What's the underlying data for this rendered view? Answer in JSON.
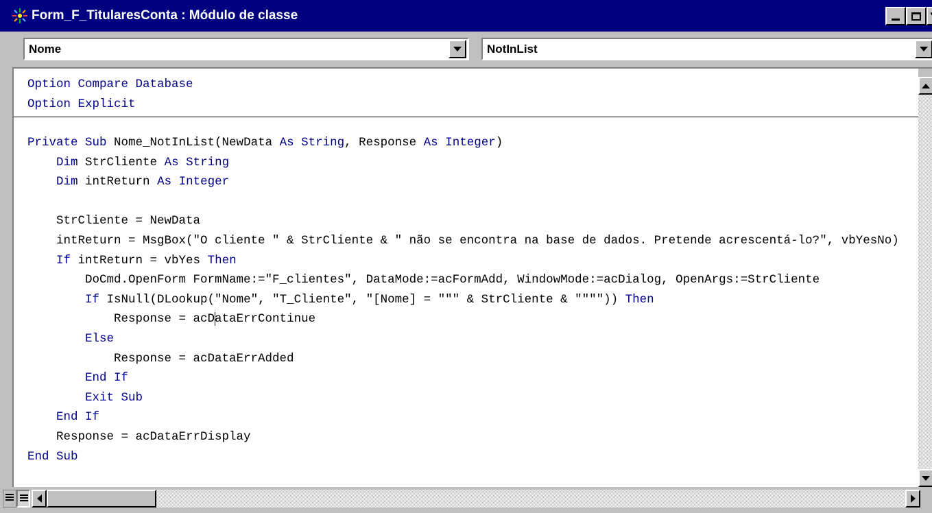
{
  "window": {
    "title": "Form_F_TitularesConta : Módulo de classe",
    "icon": "module-icon",
    "controls": [
      "minimize-icon",
      "maximize-icon",
      "close-icon"
    ]
  },
  "object_combo": {
    "value": "Nome"
  },
  "procedure_combo": {
    "value": "NotInList"
  },
  "colors": {
    "keyword": "#00008b",
    "titlebar": "#000080",
    "text": "#000000"
  },
  "code": {
    "declarations": [
      [
        [
          "Option Compare Database",
          "kw"
        ]
      ],
      [
        [
          "Option Explicit",
          "kw"
        ]
      ]
    ],
    "lines": [
      [
        [
          "Private Sub",
          "kw"
        ],
        [
          " Nome_NotInList(NewData ",
          ""
        ],
        [
          "As",
          "kw"
        ],
        [
          " ",
          ""
        ],
        [
          "String",
          "kw"
        ],
        [
          ", Response ",
          ""
        ],
        [
          "As",
          "kw"
        ],
        [
          " ",
          ""
        ],
        [
          "Integer",
          "kw"
        ],
        [
          ")",
          ""
        ]
      ],
      [
        [
          "    ",
          ""
        ],
        [
          "Dim",
          "kw"
        ],
        [
          " StrCliente ",
          ""
        ],
        [
          "As",
          "kw"
        ],
        [
          " ",
          ""
        ],
        [
          "String",
          "kw"
        ]
      ],
      [
        [
          "    ",
          ""
        ],
        [
          "Dim",
          "kw"
        ],
        [
          " intReturn ",
          ""
        ],
        [
          "As",
          "kw"
        ],
        [
          " ",
          ""
        ],
        [
          "Integer",
          "kw"
        ]
      ],
      [
        [
          "",
          ""
        ]
      ],
      [
        [
          "    StrCliente = NewData",
          ""
        ]
      ],
      [
        [
          "    intReturn = MsgBox(\"O cliente \" & StrCliente & \" não se encontra na base de dados. Pretende acrescentá-lo?\", vbYesNo)",
          ""
        ]
      ],
      [
        [
          "    ",
          ""
        ],
        [
          "If",
          "kw"
        ],
        [
          " intReturn = vbYes ",
          ""
        ],
        [
          "Then",
          "kw"
        ]
      ],
      [
        [
          "        DoCmd.OpenForm FormName:=\"F_clientes\", DataMode:=acFormAdd, WindowMode:=acDialog, OpenArgs:=StrCliente",
          ""
        ]
      ],
      [
        [
          "        ",
          ""
        ],
        [
          "If",
          "kw"
        ],
        [
          " IsNull(DLookup(\"Nome\", \"T_Cliente\", \"[Nome] = \"\"\" & StrCliente & \"\"\"\")) ",
          ""
        ],
        [
          "Then",
          "kw"
        ]
      ],
      [
        [
          "            Response = acD",
          ""
        ],
        [
          "|",
          "cursor"
        ],
        [
          "ataErrContinue",
          ""
        ]
      ],
      [
        [
          "        ",
          ""
        ],
        [
          "Else",
          "kw"
        ]
      ],
      [
        [
          "            Response = acDataErrAdded",
          ""
        ]
      ],
      [
        [
          "        ",
          ""
        ],
        [
          "End If",
          "kw"
        ]
      ],
      [
        [
          "        ",
          ""
        ],
        [
          "Exit Sub",
          "kw"
        ]
      ],
      [
        [
          "    ",
          ""
        ],
        [
          "End If",
          "kw"
        ]
      ],
      [
        [
          "    Response = acDataErrDisplay",
          ""
        ]
      ],
      [
        [
          "End Sub",
          "kw"
        ]
      ]
    ]
  },
  "view_buttons": [
    "procedure-view-icon",
    "full-module-view-icon"
  ]
}
